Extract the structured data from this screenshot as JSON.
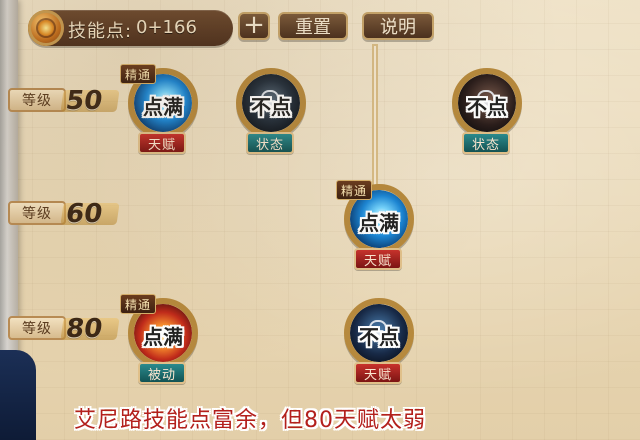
{
  "top_bar": {
    "skill_points_label": "技能点:",
    "skill_points_value": "0+166",
    "plus_label": "+",
    "reset_label": "重置",
    "help_label": "说明"
  },
  "levels": [
    {
      "label": "等级",
      "value": "50"
    },
    {
      "label": "等级",
      "value": "60"
    },
    {
      "label": "等级",
      "value": "80"
    }
  ],
  "skills": [
    {
      "mastery": "精通",
      "overlay_text": "点满",
      "tag": "天赋"
    },
    {
      "mastery": "",
      "overlay_text": "不点",
      "tag": "状态"
    },
    {
      "mastery": "",
      "overlay_text": "不点",
      "tag": "状态"
    },
    {
      "mastery": "精通",
      "overlay_text": "点满",
      "tag": "天赋"
    },
    {
      "mastery": "精通",
      "overlay_text": "点满",
      "tag": "被动"
    },
    {
      "mastery": "",
      "overlay_text": "不点",
      "tag": "天赋"
    }
  ],
  "caption": {
    "text": "艾尼路技能点富余，但80天赋太弱"
  },
  "colors": {
    "tag_red": "#b72b26",
    "tag_teal": "#1f6e70",
    "caption_red": "#b3201c"
  }
}
